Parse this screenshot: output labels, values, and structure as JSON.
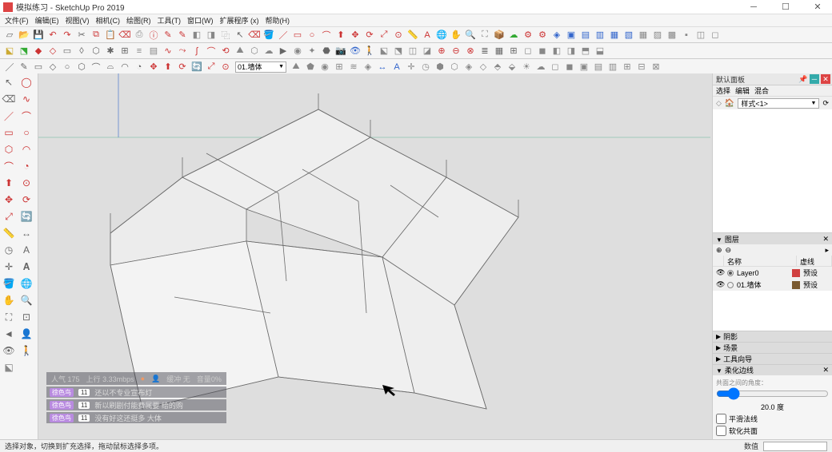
{
  "title": "模拟练习 - SketchUp Pro 2019",
  "menus": [
    "文件(F)",
    "编辑(E)",
    "视图(V)",
    "相机(C)",
    "绘图(R)",
    "工具(T)",
    "窗口(W)",
    "扩展程序 (x)",
    "帮助(H)"
  ],
  "layer_dropdown": "01.墙体",
  "right": {
    "tray_title": "默认面板",
    "tabs": [
      "选择",
      "编辑",
      "混合"
    ],
    "component_label": "样式<1>",
    "layers": {
      "title": "图层",
      "cols": {
        "name": "名称",
        "dash": "虚线"
      },
      "rows": [
        {
          "vis": true,
          "active": true,
          "name": "Layer0",
          "color": "#d04040",
          "dash": "预设"
        },
        {
          "vis": true,
          "active": false,
          "name": "01.墙体",
          "color": "#7a5a30",
          "dash": "预设"
        }
      ]
    },
    "collapsed": [
      "阴影",
      "场景",
      "工具向导"
    ],
    "soften": {
      "title": "柔化边线",
      "hint": "共面之间的角度：",
      "value": "20.0 度",
      "cb1": "平滑法线",
      "cb2": "软化共面"
    }
  },
  "status": {
    "hint": "选择对象，切换到扩充选择，拖动鼠标选择多项。",
    "measure_label": "数值"
  },
  "overlay": {
    "stats": {
      "up_label": "上行",
      "up": "3.33mbps",
      "buf_label": "缓冲",
      "buf": "无",
      "vol": "0%"
    },
    "rows": [
      {
        "name": "徐色鸟",
        "count": "11",
        "msg": "还以不专业宣布灯"
      },
      {
        "name": "徐色鸟",
        "count": "11",
        "msg": "新以刷剧付能费属要 给的购"
      },
      {
        "name": "徐色鸟",
        "count": "11",
        "msg": "没有好这还挺多  大体"
      }
    ]
  }
}
